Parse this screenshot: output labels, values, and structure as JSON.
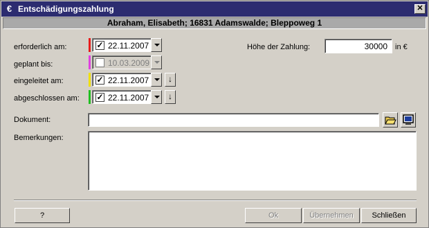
{
  "window": {
    "title": "Entschädigungszahlung",
    "title_icon": "€",
    "close_glyph": "✕"
  },
  "header": "Abraham, Elisabeth; 16831 Adamswalde; Bleppoweg 1",
  "fields": {
    "erforderlich": {
      "label": "erforderlich am:",
      "date": "22.11.2007",
      "checked": true,
      "color": "#e81c1c"
    },
    "geplant": {
      "label": "geplant bis:",
      "date": "10.03.2009",
      "checked": false,
      "color": "#e040e0"
    },
    "eingeleitet": {
      "label": "eingeleitet am:",
      "date": "22.11.2007",
      "checked": true,
      "color": "#f0e000",
      "arrow": "↓"
    },
    "abgeschlossen": {
      "label": "abgeschlossen am:",
      "date": "22.11.2007",
      "checked": true,
      "color": "#20c020",
      "arrow": "↓"
    }
  },
  "payment": {
    "label": "Höhe der Zahlung:",
    "value": "30000",
    "unit": "in €"
  },
  "dokument": {
    "label": "Dokument:",
    "value": ""
  },
  "bemerkungen": {
    "label": "Bemerkungen:",
    "value": ""
  },
  "buttons": {
    "help": "?",
    "ok": "Ok",
    "apply": "Übernehmen",
    "close": "Schließen"
  },
  "check_glyph": "✓"
}
